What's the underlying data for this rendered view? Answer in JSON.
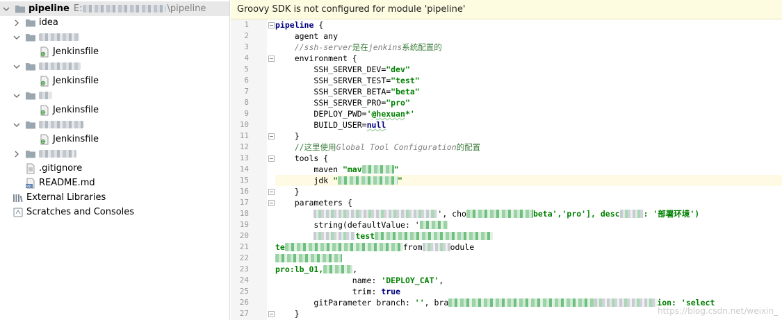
{
  "project_tree": {
    "root": {
      "name": "pipeline",
      "path_prefix": "E:",
      "path_suffix": "\\pipeline"
    },
    "items": [
      {
        "label": "idea",
        "kind": "folder"
      },
      {
        "label": "Jenkinsfile",
        "kind": "file"
      },
      {
        "label": "Jenkinsfile",
        "kind": "file"
      },
      {
        "label": "Jenkinsfile",
        "kind": "file"
      },
      {
        "label": "Jenkinsfile",
        "kind": "file"
      },
      {
        "label": ".gitignore",
        "kind": "file"
      },
      {
        "label": "README.md",
        "kind": "file"
      },
      {
        "label": "External Libraries",
        "kind": "library"
      },
      {
        "label": "Scratches and Consoles",
        "kind": "scratch"
      }
    ]
  },
  "editor": {
    "banner": "Groovy SDK is not configured for module 'pipeline'",
    "line_numbers": [
      "1",
      "2",
      "3",
      "4",
      "5",
      "6",
      "7",
      "8",
      "9",
      "10",
      "11",
      "12",
      "13",
      "14",
      "15",
      "16",
      "17",
      "18",
      "19",
      "20",
      "21",
      "22",
      "23",
      "24",
      "25",
      "26",
      "27"
    ],
    "code": {
      "l1_kw": "pipeline",
      "l1_rest": " {",
      "l2": "agent any",
      "l3_a": "//ssh-server",
      "l3_b": "是在",
      "l3_c": "jenkins",
      "l3_d": "系统配置的",
      "l4": "environment {",
      "l5_a": "SSH_SERVER_DEV=",
      "l5_b": "\"dev\"",
      "l6_a": "SSH_SERVER_TEST=",
      "l6_b": "\"test\"",
      "l7_a": "SSH_SERVER_BETA=",
      "l7_b": "\"beta\"",
      "l8_a": "SSH_SERVER_PRO=",
      "l8_b": "\"pro\"",
      "l9_a": "DEPLOY_PWD=",
      "l9_b": "'",
      "l9_c": "@hexuan",
      "l9_d": "*'",
      "l10_a": "BUILD_USER=",
      "l10_b": "null",
      "l11": "}",
      "l12_a": "//这里使用",
      "l12_b": "Global Tool Configuration",
      "l12_c": "的配置",
      "l13": "tools {",
      "l14_a": "maven ",
      "l14_b": "\"mav",
      "l14_c": "\"",
      "l15_a": "jdk ",
      "l15_b": "\"",
      "l15_c": "\"",
      "l16": "}",
      "l17": "parameters {",
      "l18_a": "', cho",
      "l18_b": "beta','pro'], desc",
      "l18_c": ": '部署环境')",
      "l19_a": "string(defaultValue: '",
      "l20_a": "test",
      "l21_a": "te",
      "l21_b": "from",
      "l21_c": "odule",
      "l23_a": "pro:lb_01,",
      "l23_b": ",",
      "l24_a": "name: ",
      "l24_b": "'DEPLOY_CAT'",
      "l24_c": ",",
      "l25_a": "trim: ",
      "l25_b": "true",
      "l26_a": "gitParameter branch: ",
      "l26_b": "''",
      "l26_c": ", bra",
      "l26_d": "ion: 'select",
      "l27": "}"
    },
    "watermark": "https://blog.csdn.net/weixin_"
  },
  "colors": {
    "keyword": "#000080",
    "string": "#008000",
    "comment": "#808080",
    "banner_bg": "#fdfbe0",
    "caret_line": "#fffae3"
  },
  "icons": [
    "chevron-down-icon",
    "chevron-right-icon",
    "folder-icon",
    "groovy-file-icon",
    "text-file-icon",
    "markdown-file-icon",
    "library-icon",
    "scratch-icon",
    "fold-marker-icon"
  ]
}
